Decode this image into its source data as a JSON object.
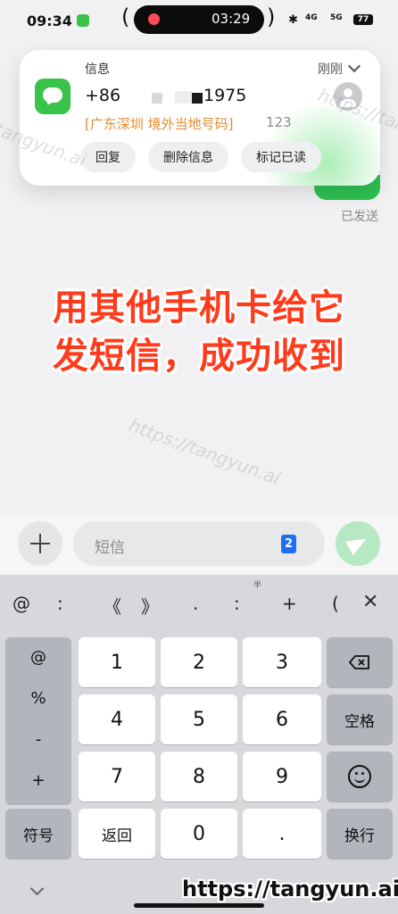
{
  "status_bar": {
    "time": "09:34",
    "recording_time": "03:29",
    "signal_1": "4G",
    "signal_2": "5G",
    "battery": "77"
  },
  "notification": {
    "app_name": "信息",
    "time": "刚刚",
    "sender_prefix": "+86",
    "sender_suffix": "1975",
    "location_tag": "[广东深圳 境外当地号码]",
    "location_number": "123",
    "actions": [
      "回复",
      "删除信息",
      "标记已读"
    ]
  },
  "conversation": {
    "sent_status": "已发送"
  },
  "banner": {
    "line1": "用其他手机卡给它",
    "line2": "发短信，成功收到"
  },
  "watermarks": {
    "text": "https://tangyun.ai",
    "short": "tangyun.ai",
    "site": "https://tangyun.ai"
  },
  "compose": {
    "placeholder": "短信",
    "sim_slot": "2"
  },
  "keyboard": {
    "symbol_row": [
      "@",
      ":",
      "《",
      "》",
      ".",
      ":",
      "+",
      "("
    ],
    "symbol_superscript": "半",
    "side_column": [
      "@",
      "%",
      "-",
      "+"
    ],
    "digits": [
      "1",
      "2",
      "3",
      "4",
      "5",
      "6",
      "7",
      "8",
      "9",
      "0"
    ],
    "symbols_key": "符号",
    "back_key": "返回",
    "dot_key": ".",
    "space_key": "空格",
    "enter_key": "换行"
  },
  "colors": {
    "accent_green": "#3ac34b",
    "banner_red": "#ff3b1c",
    "location_orange": "#e8892c",
    "sim_blue": "#1e6ef5"
  }
}
